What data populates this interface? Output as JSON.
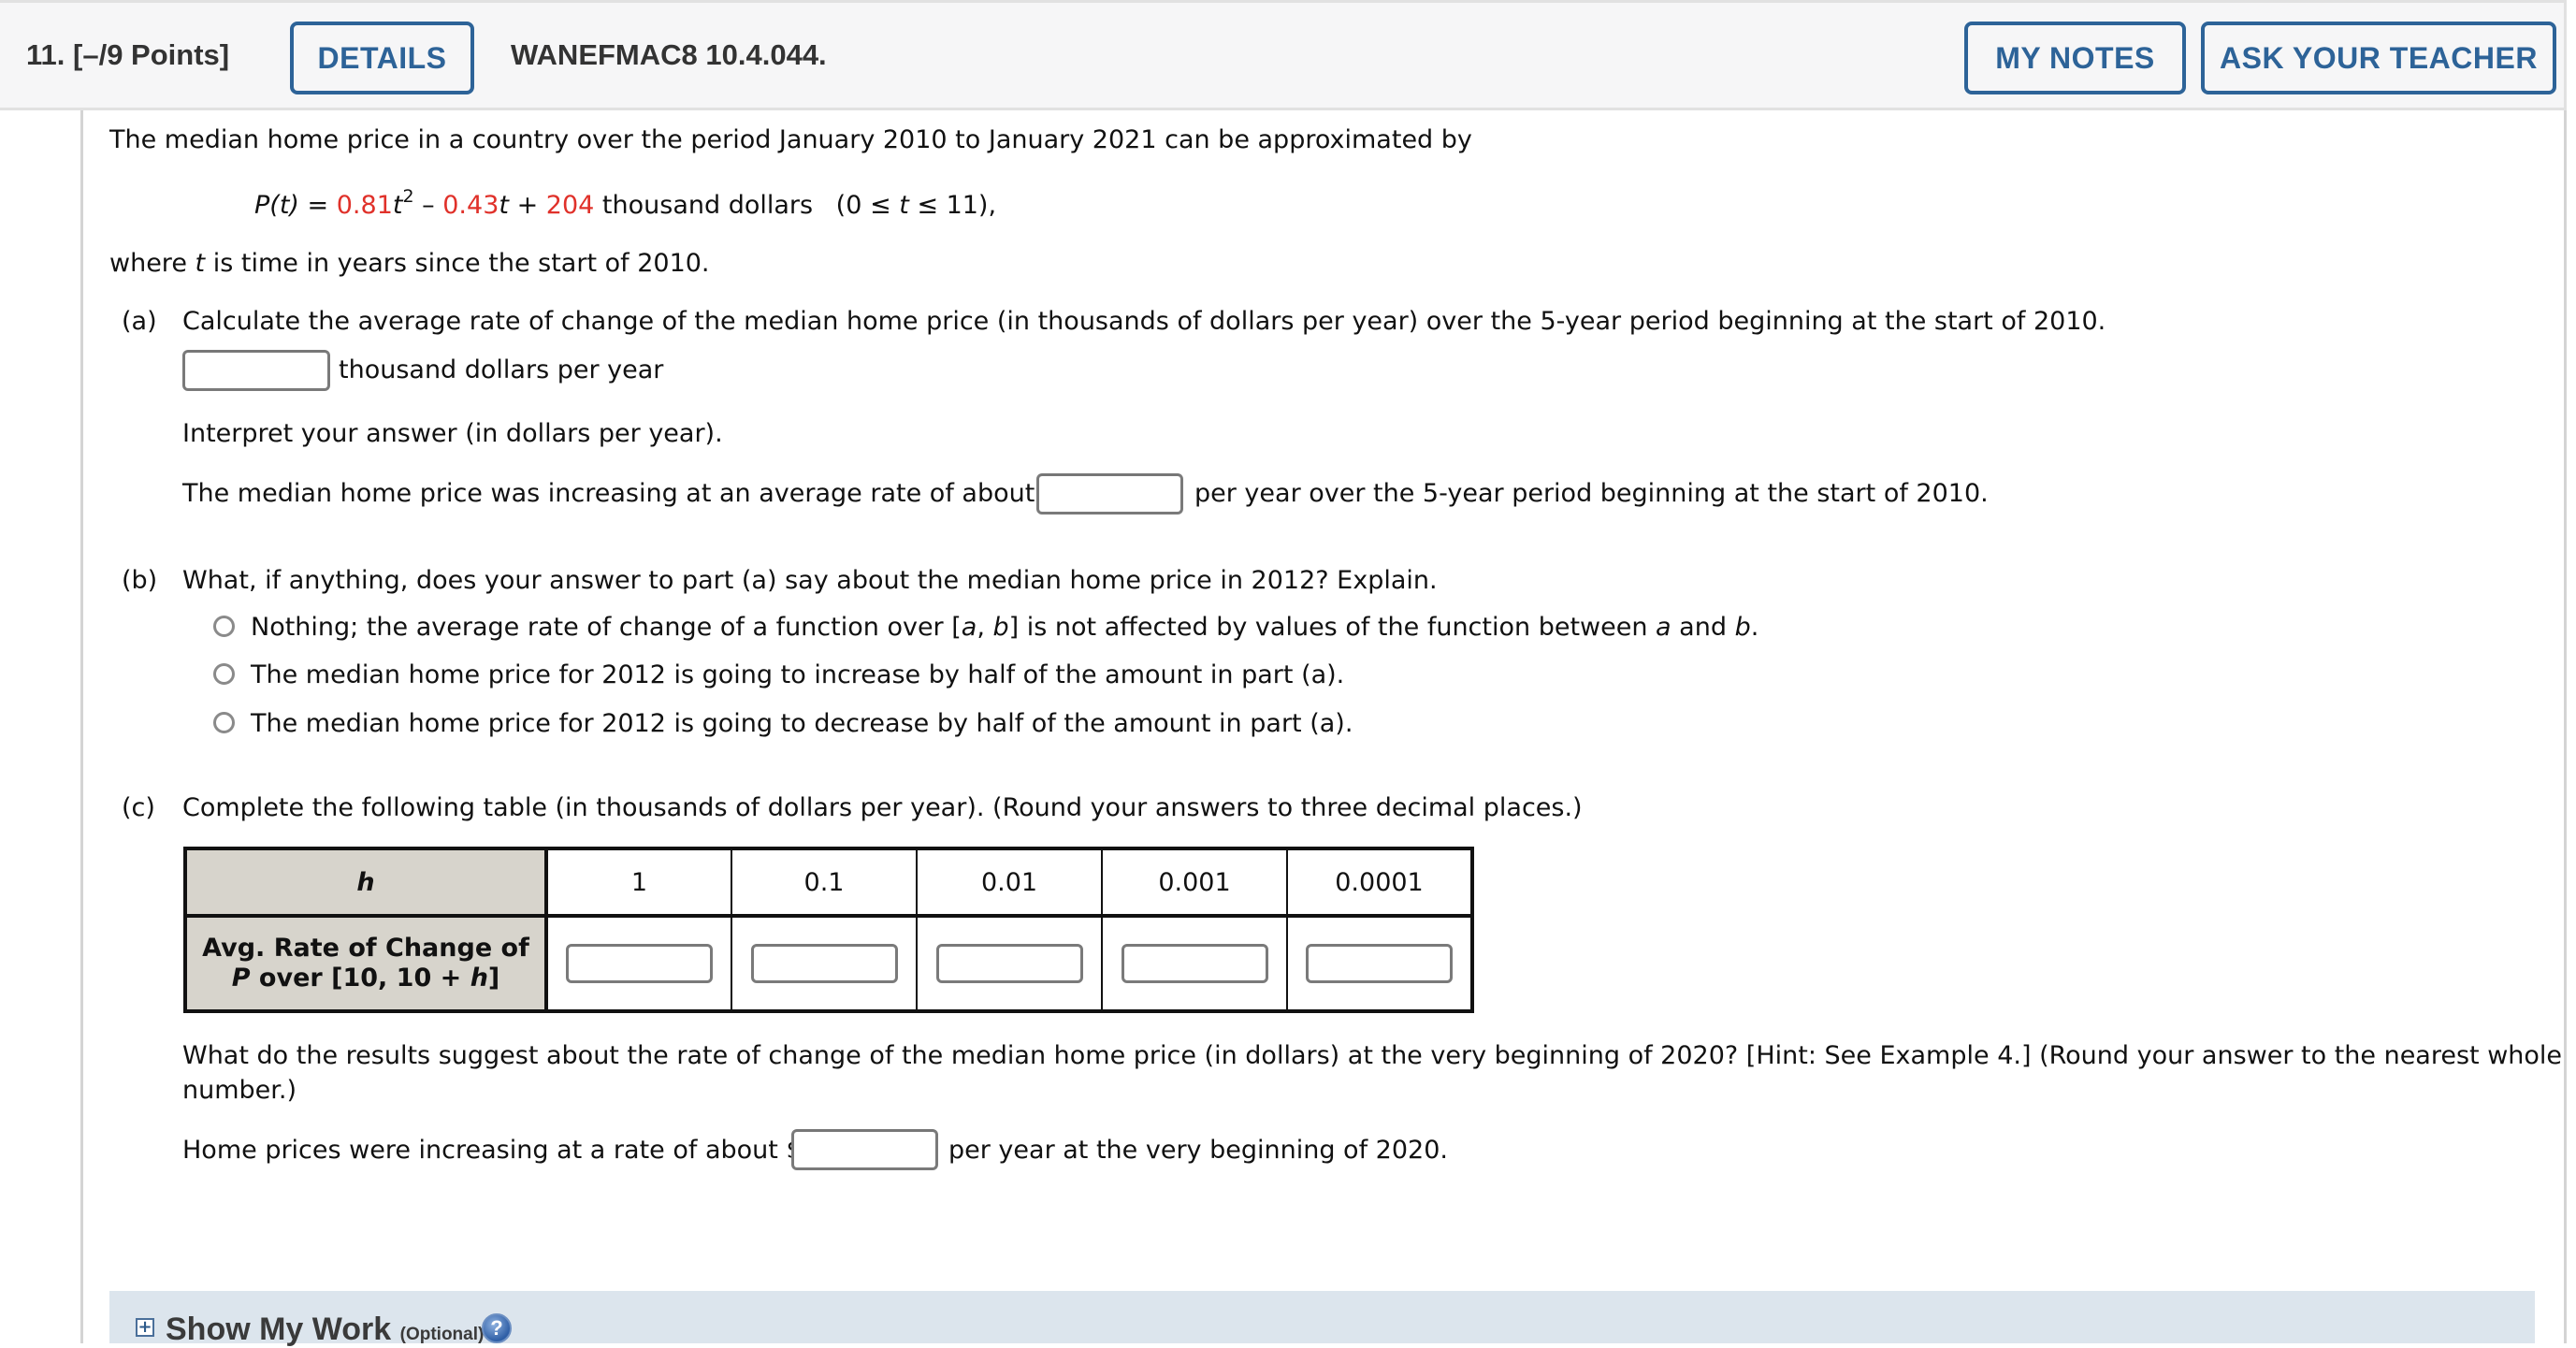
{
  "header": {
    "question_number": "11.",
    "points": "[–/9 Points]",
    "details_label": "DETAILS",
    "problem_code": "WANEFMAC8 10.4.044.",
    "my_notes_label": "MY NOTES",
    "ask_teacher_label": "ASK YOUR TEACHER",
    "accent_color": "#2d6398"
  },
  "intro": {
    "text": "The median home price in a country over the period January 2010 to January 2021 can be approximated by",
    "formula": {
      "lhs": "P(t)",
      "equals": "=",
      "coef_a": "0.81",
      "var_t2": "t",
      "exp": "2",
      "minus": "–",
      "coef_b": "0.43",
      "var_t": "t",
      "plus": "+",
      "const": "204",
      "units": "thousand dollars",
      "domain_open": "(0 ≤",
      "domain_t": "t",
      "domain_close": "≤ 11),",
      "highlight_color": "#e0312a"
    },
    "where_pre": "where",
    "where_var": "t",
    "where_post": "is time in years since the start of 2010."
  },
  "part_a": {
    "label": "(a)",
    "question": "Calculate the average rate of change of the median home price (in thousands of dollars per year) over the 5-year period beginning at the start of 2010.",
    "answer_value": "",
    "answer_units": "thousand dollars per year",
    "interpret_prompt": "Interpret your answer (in dollars per year).",
    "interpret_pre": "The median home price was increasing at an average rate of about $",
    "interpret_value": "",
    "interpret_post": "per year over the 5-year period beginning at the start of 2010."
  },
  "part_b": {
    "label": "(b)",
    "question": "What, if anything, does your answer to part (a) say about the median home price in 2012? Explain.",
    "options": [
      {
        "pre": "Nothing; the average rate of change of a function over [",
        "a": "a",
        "mid": ", ",
        "b": "b",
        "mid2": "] is not affected by values of the function between ",
        "a2": "a",
        "and": " and ",
        "b2": "b",
        "end": ".",
        "selected": false
      },
      {
        "text": "The median home price for 2012 is going to increase by half of the amount in part (a).",
        "selected": false
      },
      {
        "text": "The median home price for 2012 is going to decrease by half of the amount in part (a).",
        "selected": false
      }
    ]
  },
  "part_c": {
    "label": "(c)",
    "question": "Complete the following table (in thousands of dollars per year). (Round your answers to three decimal places.)",
    "table": {
      "row1_header": "h",
      "row2_header_line1": "Avg. Rate of Change of",
      "row2_header_P": "P",
      "row2_header_line2_mid": " over [10, 10 + ",
      "row2_header_h": "h",
      "row2_header_line2_end": "]",
      "h_values": [
        "1",
        "0.1",
        "0.01",
        "0.001",
        "0.0001"
      ],
      "answers": [
        "",
        "",
        "",
        "",
        ""
      ],
      "header_bg": "#d7d4cc"
    },
    "followup_line1": "What do the results suggest about the rate of change of the median home price (in dollars) at the very beginning of 2020? [Hint: See Example 4.] (Round your answer to the nearest whole",
    "followup_line2": "number.)",
    "final_pre": "Home prices were increasing at a rate of about $",
    "final_value": "",
    "final_post": "per year at the very beginning of 2020."
  },
  "show_my_work": {
    "expand_icon": "plus-box-icon",
    "title": "Show My Work",
    "optional": "(Optional)",
    "help_icon": "question-mark-icon",
    "help_glyph": "?"
  }
}
